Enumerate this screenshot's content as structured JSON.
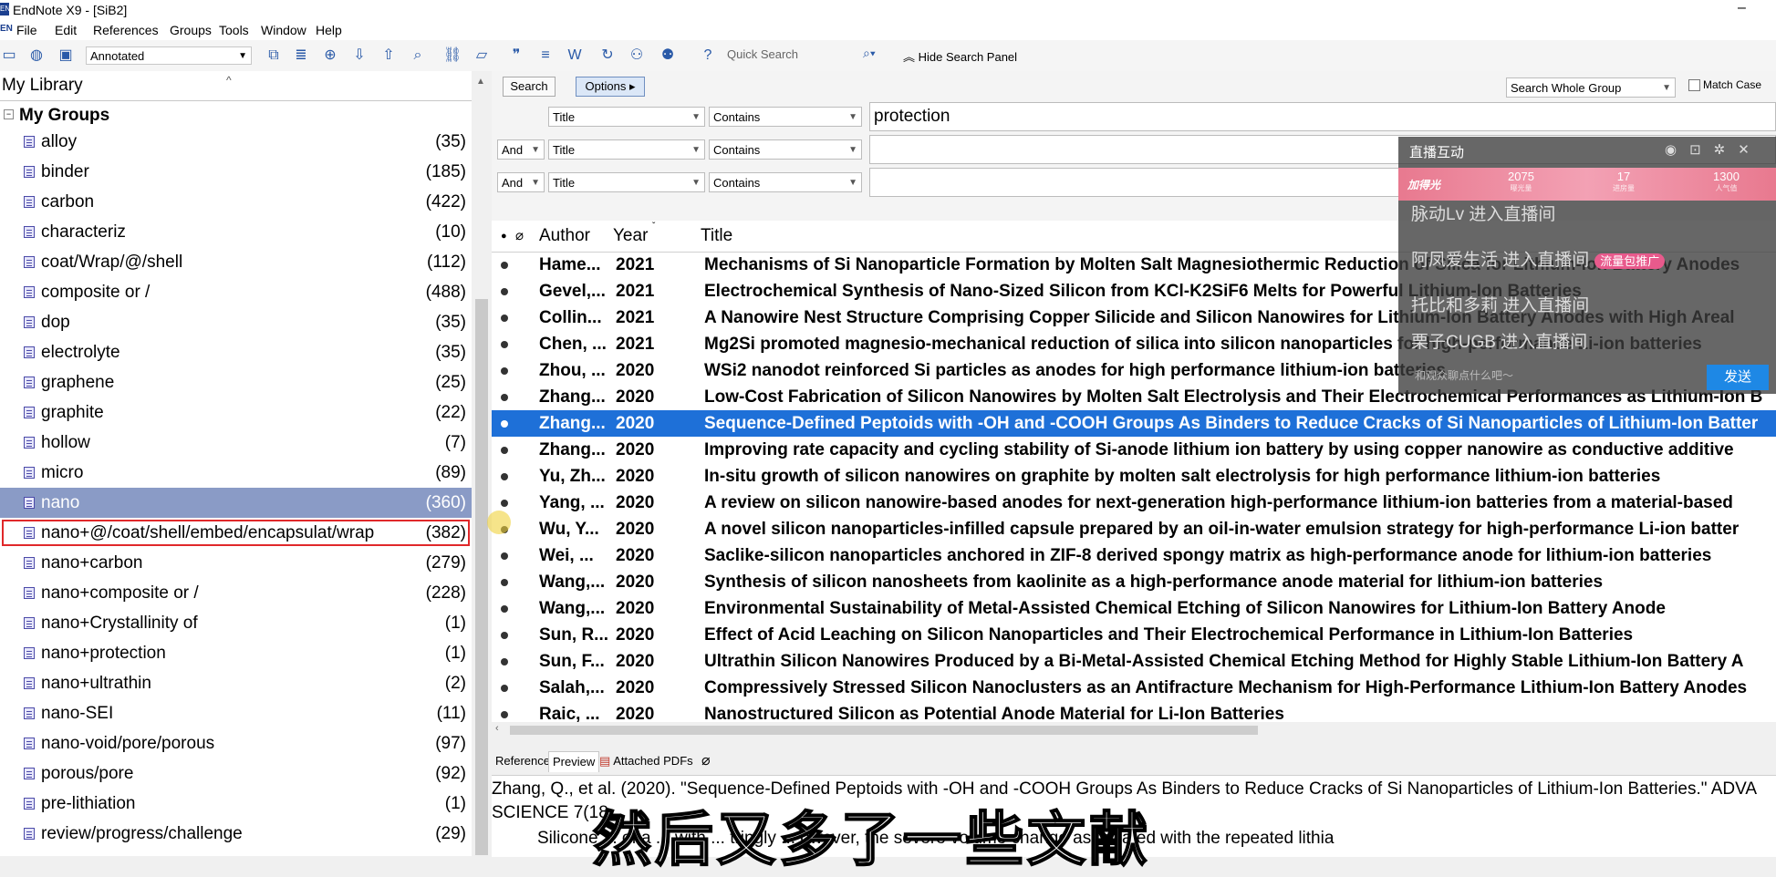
{
  "window": {
    "title": "EndNote X9 - [SiB2]"
  },
  "menu": [
    "File",
    "Edit",
    "References",
    "Groups",
    "Tools",
    "Window",
    "Help"
  ],
  "toolbar": {
    "style": "Annotated",
    "quick_search_placeholder": "Quick Search",
    "hide_search_panel": "Hide Search Panel"
  },
  "library": {
    "header": "My Library",
    "groups_title": "My Groups"
  },
  "groups": [
    {
      "name": "alloy",
      "count": "(35)"
    },
    {
      "name": "binder",
      "count": "(185)"
    },
    {
      "name": "carbon",
      "count": "(422)"
    },
    {
      "name": "characteriz",
      "count": "(10)"
    },
    {
      "name": "coat/Wrap/@/shell",
      "count": "(112)"
    },
    {
      "name": "composite or /",
      "count": "(488)"
    },
    {
      "name": "dop",
      "count": "(35)"
    },
    {
      "name": "electrolyte",
      "count": "(35)"
    },
    {
      "name": "graphene",
      "count": "(25)"
    },
    {
      "name": "graphite",
      "count": "(22)"
    },
    {
      "name": "hollow",
      "count": "(7)"
    },
    {
      "name": "micro",
      "count": "(89)"
    },
    {
      "name": "nano",
      "count": "(360)"
    },
    {
      "name": "nano+@/coat/shell/embed/encapsulat/wrap",
      "count": "(382)"
    },
    {
      "name": "nano+carbon",
      "count": "(279)"
    },
    {
      "name": "nano+composite or /",
      "count": "(228)"
    },
    {
      "name": "nano+Crystallinity of",
      "count": "(1)"
    },
    {
      "name": "nano+protection",
      "count": "(1)"
    },
    {
      "name": "nano+ultrathin",
      "count": "(2)"
    },
    {
      "name": "nano-SEI",
      "count": "(11)"
    },
    {
      "name": "nano-void/pore/porous",
      "count": "(97)"
    },
    {
      "name": "porous/pore",
      "count": "(92)"
    },
    {
      "name": "pre-lithiation",
      "count": "(1)"
    },
    {
      "name": "review/progress/challenge",
      "count": "(29)"
    }
  ],
  "search": {
    "search_btn": "Search",
    "options_btn": "Options",
    "scope": "Search Whole Group",
    "match_case": "Match Case",
    "rows": [
      {
        "bool": "",
        "field": "Title",
        "op": "Contains",
        "value": "protection"
      },
      {
        "bool": "And",
        "field": "Title",
        "op": "Contains",
        "value": ""
      },
      {
        "bool": "And",
        "field": "Title",
        "op": "Contains",
        "value": ""
      }
    ]
  },
  "columns": {
    "author": "Author",
    "year": "Year",
    "title": "Title"
  },
  "references": [
    {
      "author": "Hame...",
      "year": "2021",
      "title": "Mechanisms of Si Nanoparticle Formation by Molten Salt Magnesiothermic Reduction of Silica for Lithium-Ion Battery Anodes"
    },
    {
      "author": "Gevel,...",
      "year": "2021",
      "title": "Electrochemical Synthesis of Nano-Sized Silicon from KCl-K2SiF6 Melts for Powerful Lithium-Ion Batteries"
    },
    {
      "author": "Collin...",
      "year": "2021",
      "title": "A Nanowire Nest Structure Comprising Copper Silicide and Silicon Nanowires for Lithium-Ion Battery Anodes with High Areal"
    },
    {
      "author": "Chen, ...",
      "year": "2021",
      "title": "Mg2Si promoted magnesio-mechanical reduction of silica into silicon nanoparticles for high-performance Li-ion batteries"
    },
    {
      "author": "Zhou, ...",
      "year": "2020",
      "title": "WSi2 nanodot reinforced Si particles as anodes for high performance lithium-ion batteries"
    },
    {
      "author": "Zhang...",
      "year": "2020",
      "title": "Low-Cost Fabrication of Silicon Nanowires by Molten Salt Electrolysis and Their Electrochemical Performances as Lithium-Ion B"
    },
    {
      "author": "Zhang...",
      "year": "2020",
      "title": "Sequence-Defined Peptoids with -OH and -COOH Groups As Binders to Reduce Cracks of Si Nanoparticles of Lithium-Ion Batter"
    },
    {
      "author": "Zhang...",
      "year": "2020",
      "title": "Improving rate capacity and cycling stability of Si-anode lithium ion battery by using copper nanowire as conductive additive"
    },
    {
      "author": "Yu, Zh...",
      "year": "2020",
      "title": "In-situ growth of silicon nanowires on graphite by molten salt electrolysis for high performance lithium-ion batteries"
    },
    {
      "author": "Yang, ...",
      "year": "2020",
      "title": "A review on silicon nanowire-based anodes for next-generation high-performance lithium-ion batteries from a material-based"
    },
    {
      "author": "Wu, Y...",
      "year": "2020",
      "title": "A novel silicon nanoparticles-infilled capsule prepared by an oil-in-water emulsion strategy for high-performance Li-ion batter"
    },
    {
      "author": "Wei, ...",
      "year": "2020",
      "title": "Saclike-silicon nanoparticles anchored in ZIF-8 derived spongy matrix as high-performance anode for lithium-ion batteries"
    },
    {
      "author": "Wang,...",
      "year": "2020",
      "title": "Synthesis of silicon nanosheets from kaolinite as a high-performance anode material for lithium-ion batteries"
    },
    {
      "author": "Wang,...",
      "year": "2020",
      "title": "Environmental Sustainability of Metal-Assisted Chemical Etching of Silicon Nanowires for Lithium-Ion Battery Anode"
    },
    {
      "author": "Sun, R...",
      "year": "2020",
      "title": "Effect of Acid Leaching on Silicon Nanoparticles and Their Electrochemical Performance in Lithium-Ion Batteries"
    },
    {
      "author": "Sun, F...",
      "year": "2020",
      "title": "Ultrathin Silicon Nanowires Produced by a Bi-Metal-Assisted Chemical Etching Method for Highly Stable Lithium-Ion Battery A"
    },
    {
      "author": "Salah,...",
      "year": "2020",
      "title": "Compressively Stressed Silicon Nanoclusters as an Antifracture Mechanism for High-Performance Lithium-Ion Battery Anodes"
    },
    {
      "author": "Raic, ...",
      "year": "2020",
      "title": "Nanostructured Silicon as Potential Anode Material for Li-Ion Batteries"
    }
  ],
  "tabs": [
    "Reference",
    "Preview",
    "Attached PDFs"
  ],
  "preview": {
    "line1": "Zhang, Q., et al. (2020). \"Sequence-Defined Peptoids with -OH and -COOH Groups As Binders to Reduce Cracks of Si Nanoparticles of Lithium-Ion Batteries.\" ADVA",
    "line2": "SCIENCE 7(18",
    "line3": "Silicone ... of a ... with ... tringly ... owever, the severe volume change associated with the repeated lithia"
  },
  "overlay": {
    "title": "直播互动",
    "stats": [
      {
        "value": "加得光",
        "label": ""
      },
      {
        "value": "2075",
        "label": "曝光量"
      },
      {
        "value": "17",
        "label": "进房量"
      },
      {
        "value": "1300",
        "label": "人气值"
      }
    ],
    "lines": [
      {
        "text": "脉动Lv 进入直播间",
        "tag": ""
      },
      {
        "text": "阿凤爱生活 进入直播间",
        "tag": "流量包推广"
      },
      {
        "text": "托比和多莉 进入直播间",
        "tag": ""
      },
      {
        "text": "栗子CUGB 进入直播间",
        "tag": ""
      }
    ],
    "input_placeholder": "和观众聊点什么吧～",
    "send": "发送"
  },
  "subtitle": "然后又多了一些文献"
}
